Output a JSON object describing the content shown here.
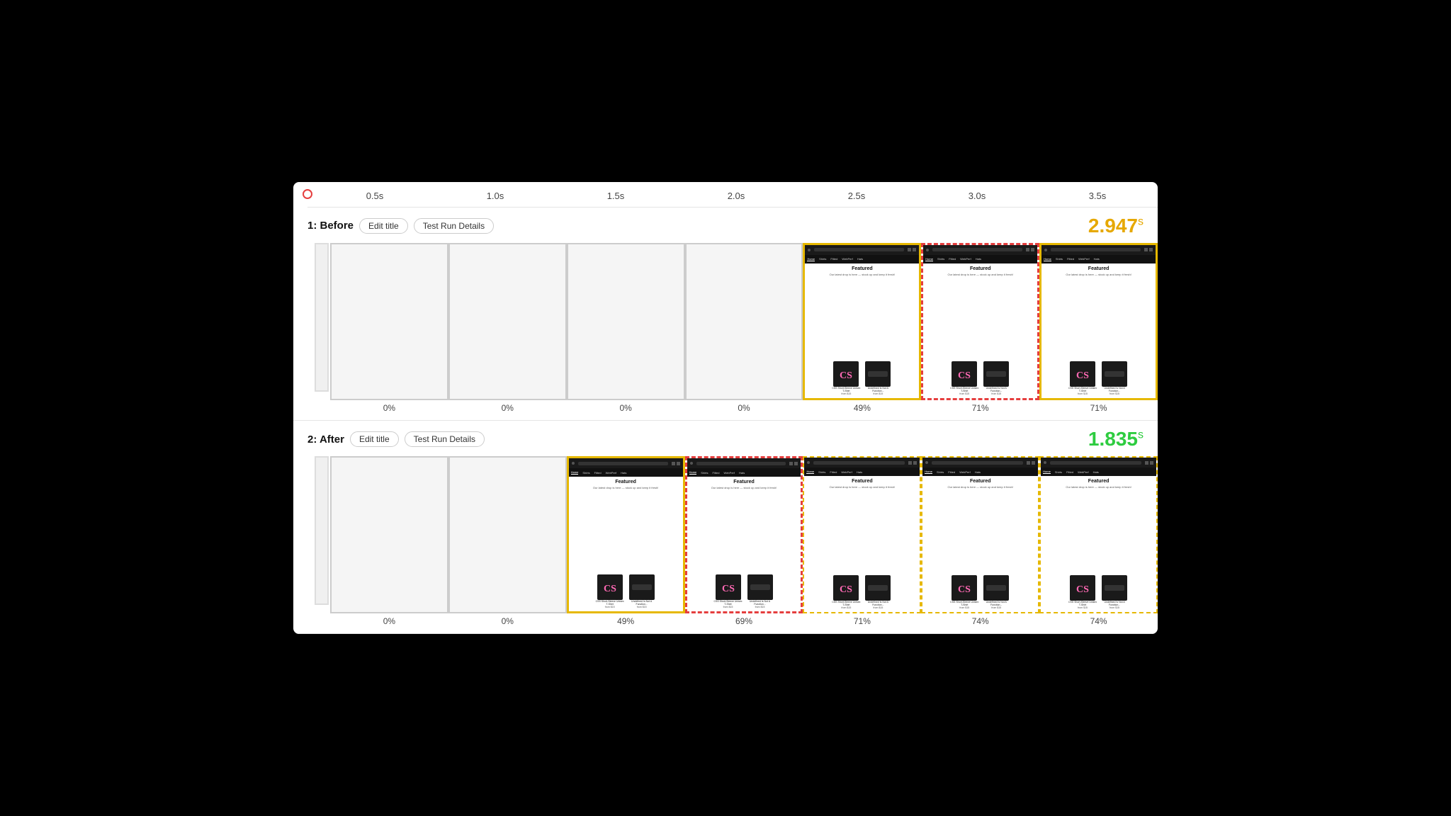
{
  "timeline": {
    "ticks": [
      "0.5s",
      "1.0s",
      "1.5s",
      "2.0s",
      "2.5s",
      "3.0s",
      "3.5s"
    ]
  },
  "before": {
    "title": "1: Before",
    "edit_label": "Edit title",
    "details_label": "Test Run Details",
    "score": "2.947",
    "score_unit": "s",
    "frames": [
      {
        "pct": "0%",
        "type": "blank"
      },
      {
        "pct": "0%",
        "type": "blank"
      },
      {
        "pct": "0%",
        "type": "blank"
      },
      {
        "pct": "0%",
        "type": "blank"
      },
      {
        "pct": "49%",
        "type": "browser",
        "highlight": "gold"
      },
      {
        "pct": "71%",
        "type": "browser",
        "highlight": "red"
      },
      {
        "pct": "71%",
        "type": "browser",
        "highlight": "gold"
      }
    ]
  },
  "after": {
    "title": "2: After",
    "edit_label": "Edit title",
    "details_label": "Test Run Details",
    "score": "1.835",
    "score_unit": "s",
    "frames": [
      {
        "pct": "0%",
        "type": "blank"
      },
      {
        "pct": "0%",
        "type": "blank"
      },
      {
        "pct": "49%",
        "type": "browser",
        "highlight": "gold"
      },
      {
        "pct": "69%",
        "type": "browser",
        "highlight": "red"
      },
      {
        "pct": "71%",
        "type": "browser",
        "highlight": "gold2"
      },
      {
        "pct": "74%",
        "type": "browser",
        "highlight": "gold2"
      },
      {
        "pct": "74%",
        "type": "browser",
        "highlight": "gold2"
      }
    ]
  },
  "nav_items": [
    "Menu",
    "Home",
    "Shirts",
    "Fitted",
    "WebPerf",
    "Hats"
  ],
  "featured_text": "Featured",
  "featured_sub": "Our latest drop is here — stock up and keep it fresh!",
  "product1_name": "CSS Short-Sleeve Unisex T-Shirt",
  "product1_price": "from $15",
  "product2_name": "Undefined Is Not A Function Short-Sleeve Unisex T-Shirt",
  "product2_price": "from $15"
}
